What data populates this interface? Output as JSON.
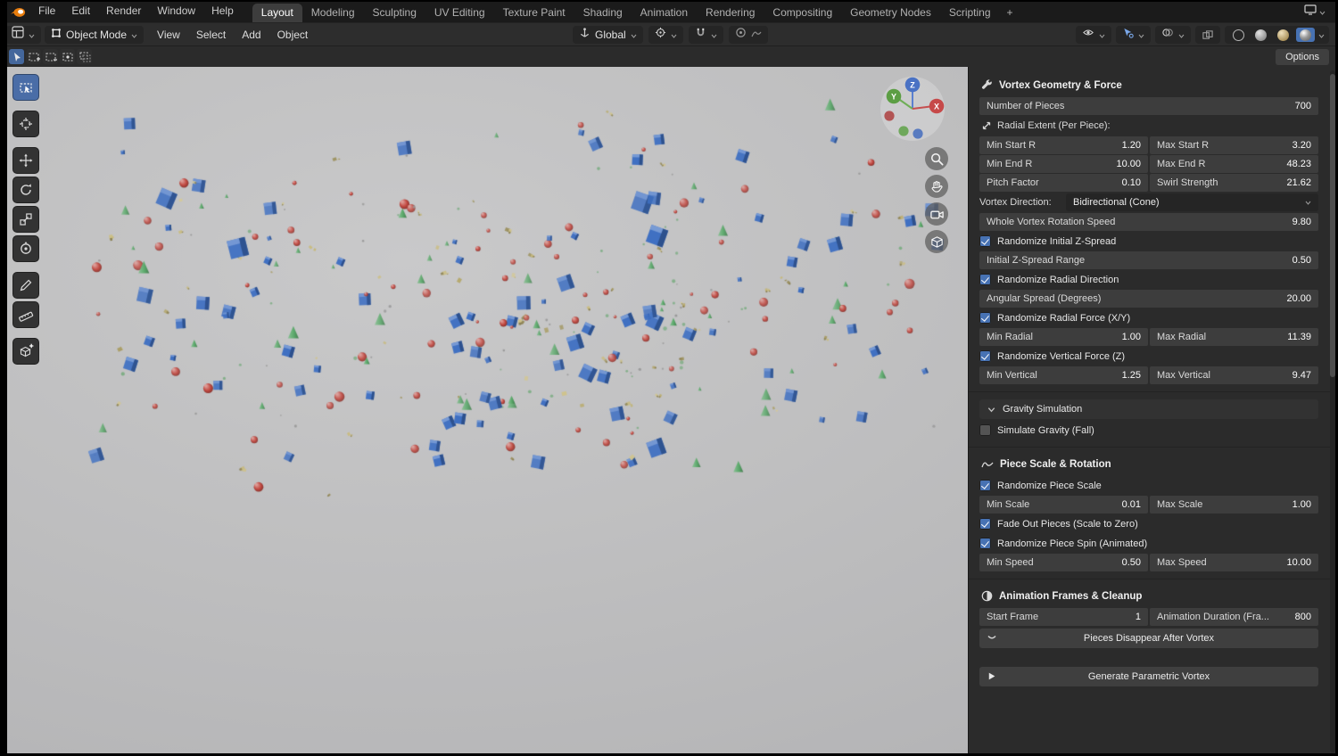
{
  "topbar": {
    "menus": [
      "File",
      "Edit",
      "Render",
      "Window",
      "Help"
    ],
    "tabs": [
      "Layout",
      "Modeling",
      "Sculpting",
      "UV Editing",
      "Texture Paint",
      "Shading",
      "Animation",
      "Rendering",
      "Compositing",
      "Geometry Nodes",
      "Scripting"
    ],
    "active_tab": "Layout",
    "new_tab_label": "+"
  },
  "viewport_header": {
    "mode": "Object Mode",
    "menus": [
      "View",
      "Select",
      "Add",
      "Object"
    ],
    "orientation": "Global",
    "shading_modes": [
      "wireframe",
      "solid",
      "material",
      "rendered"
    ],
    "active_shading": "rendered"
  },
  "tool_settings": {
    "select_modes": [
      "set",
      "extend",
      "subtract",
      "invert",
      "intersect"
    ],
    "options_label": "Options"
  },
  "left_toolbar": [
    "box-select",
    "cursor",
    "move",
    "rotate",
    "scale",
    "transform",
    "annotate",
    "measure",
    "add-cube"
  ],
  "gizmo_axes": {
    "x": "X",
    "y": "Y",
    "z": "Z"
  },
  "viewport": {
    "nav_icons": [
      "zoom",
      "pan",
      "camera",
      "grid"
    ],
    "scatter": {
      "seed": 42,
      "count": 295,
      "cluster_count": 55,
      "cluster_center": [
        650,
        340
      ],
      "colors": {
        "cube": "#3e6fc2",
        "sphere": "#c2473f",
        "cone": "#58a868",
        "debris": "#c6b878",
        "dot_green": "#7fae86",
        "dot_gray": "#9a9a9a"
      }
    }
  },
  "panel": {
    "rows": [
      {
        "t": "header",
        "icon": "wrench",
        "label": "Vortex Geometry & Force"
      },
      {
        "t": "slider",
        "label": "Number of Pieces",
        "value": "700"
      },
      {
        "t": "subhead",
        "icon": "arrows",
        "label": "Radial Extent (Per Piece):"
      },
      {
        "t": "pair",
        "cells": [
          {
            "label": "Min Start R",
            "value": "1.20"
          },
          {
            "label": "Max Start R",
            "value": "3.20"
          }
        ]
      },
      {
        "t": "pair",
        "cells": [
          {
            "label": "Min End R",
            "value": "10.00"
          },
          {
            "label": "Max End R",
            "value": "48.23"
          }
        ]
      },
      {
        "t": "pair",
        "cells": [
          {
            "label": "Pitch Factor",
            "value": "0.10"
          },
          {
            "label": "Swirl Strength",
            "value": "21.62"
          }
        ]
      },
      {
        "t": "enum",
        "label": "Vortex Direction:",
        "value": "Bidirectional (Cone)"
      },
      {
        "t": "slider",
        "label": "Whole Vortex Rotation Speed",
        "value": "9.80"
      },
      {
        "t": "check",
        "label": "Randomize Initial Z-Spread",
        "checked": true
      },
      {
        "t": "slider",
        "label": "Initial Z-Spread Range",
        "value": "0.50"
      },
      {
        "t": "check",
        "label": "Randomize Radial Direction",
        "checked": true
      },
      {
        "t": "slider",
        "label": "Angular Spread (Degrees)",
        "value": "20.00"
      },
      {
        "t": "check",
        "label": "Randomize Radial Force (X/Y)",
        "checked": true
      },
      {
        "t": "pair",
        "cells": [
          {
            "label": "Min Radial",
            "value": "1.00"
          },
          {
            "label": "Max Radial",
            "value": "11.39"
          }
        ]
      },
      {
        "t": "check",
        "label": "Randomize Vertical Force (Z)",
        "checked": true
      },
      {
        "t": "pair",
        "cells": [
          {
            "label": "Min Vertical",
            "value": "1.25"
          },
          {
            "label": "Max Vertical",
            "value": "9.47"
          }
        ]
      },
      {
        "t": "gap"
      },
      {
        "t": "section",
        "label": "Gravity Simulation"
      },
      {
        "t": "check",
        "label": "Simulate Gravity (Fall)",
        "checked": false
      },
      {
        "t": "gap"
      },
      {
        "t": "header",
        "icon": "wave",
        "label": "Piece Scale & Rotation"
      },
      {
        "t": "check",
        "label": "Randomize Piece Scale",
        "checked": true
      },
      {
        "t": "pair",
        "cells": [
          {
            "label": "Min Scale",
            "value": "0.01"
          },
          {
            "label": "Max Scale",
            "value": "1.00"
          }
        ]
      },
      {
        "t": "check",
        "label": "Fade Out Pieces (Scale to Zero)",
        "checked": true
      },
      {
        "t": "check",
        "label": "Randomize Piece Spin (Animated)",
        "checked": true
      },
      {
        "t": "pair",
        "cells": [
          {
            "label": "Min Speed",
            "value": "0.50"
          },
          {
            "label": "Max Speed",
            "value": "10.00"
          }
        ]
      },
      {
        "t": "gap"
      },
      {
        "t": "header",
        "icon": "clock",
        "label": "Animation Frames & Cleanup"
      },
      {
        "t": "pair",
        "cells": [
          {
            "label": "Start Frame",
            "value": "1"
          },
          {
            "label": "Animation Duration (Fra...",
            "value": "800"
          }
        ]
      },
      {
        "t": "button",
        "icon": "chevron",
        "label": "Pieces Disappear After Vortex"
      },
      {
        "t": "gap-small"
      },
      {
        "t": "button",
        "icon": "play",
        "label": "Generate Parametric Vortex"
      }
    ]
  }
}
